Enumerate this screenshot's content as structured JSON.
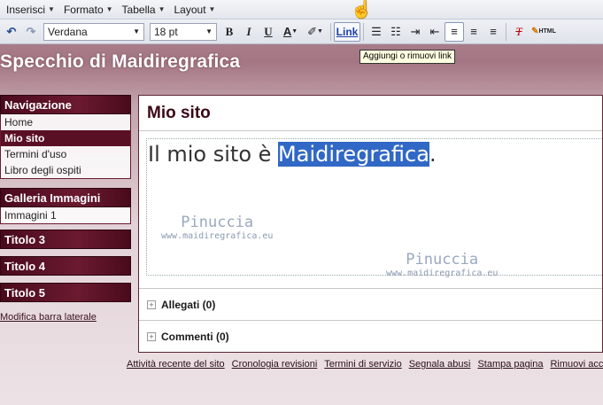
{
  "menubar": {
    "items": [
      "Inserisci",
      "Formato",
      "Tabella",
      "Layout"
    ]
  },
  "toolbar": {
    "font": "Verdana",
    "size": "18 pt",
    "bold": "B",
    "italic": "I",
    "underline": "U",
    "textcolor": "A",
    "link": "Link",
    "html": "HTML"
  },
  "tooltip": {
    "text": "Aggiungi o rimuovi link"
  },
  "site": {
    "title": "Specchio di Maidiregrafica"
  },
  "sidebar": {
    "nav_title": "Navigazione",
    "nav_items": [
      "Home",
      "Mio sito",
      "Termini d'uso",
      "Libro degli ospiti"
    ],
    "gallery_title": "Galleria Immagini",
    "gallery_items": [
      "Immagini 1"
    ],
    "extra_titles": [
      "Titolo 3",
      "Titolo 4",
      "Titolo 5"
    ],
    "edit_link": "Modifica barra laterale"
  },
  "page": {
    "title": "Mio sito",
    "text_before": "Il mio sito è ",
    "text_selected": "Maidiregrafica",
    "text_after": ".",
    "attachments": "Allegati (0)",
    "comments": "Commenti (0)"
  },
  "watermark": {
    "name": "Pinuccia",
    "url": "www.maidiregrafica.eu"
  },
  "footer": {
    "links": [
      "Attività recente del sito",
      "Cronologia revisioni",
      "Termini di servizio",
      "Segnala abusi",
      "Stampa pagina",
      "Rimuovi accesso"
    ]
  },
  "colors": {
    "header": "#5a1024",
    "selection": "#3168c6",
    "link": "#1a3ea8"
  }
}
